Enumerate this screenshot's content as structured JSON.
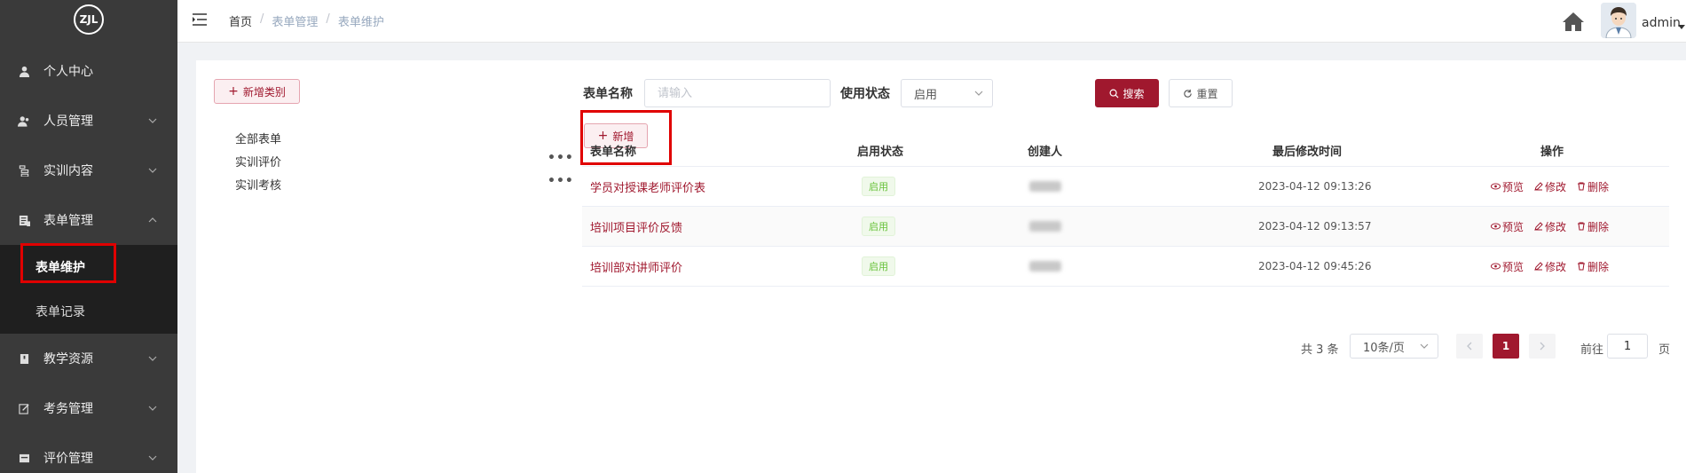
{
  "sidebar": {
    "logo_text": "ZJL",
    "items": [
      {
        "label": "个人中心"
      },
      {
        "label": "人员管理"
      },
      {
        "label": "实训内容"
      },
      {
        "label": "表单管理"
      },
      {
        "label": "表单维护"
      },
      {
        "label": "表单记录"
      },
      {
        "label": "教学资源"
      },
      {
        "label": "考务管理"
      },
      {
        "label": "评价管理"
      }
    ]
  },
  "header": {
    "breadcrumb": [
      "首页",
      "表单管理",
      "表单维护"
    ],
    "separator": "/",
    "username": "admin"
  },
  "left_panel": {
    "add_category_label": "新增类别",
    "tree": [
      {
        "label": "全部表单"
      },
      {
        "label": "实训评价",
        "more": "•••"
      },
      {
        "label": "实训考核",
        "more": "•••"
      }
    ]
  },
  "search": {
    "name_label": "表单名称",
    "name_placeholder": "请输入",
    "status_label": "使用状态",
    "status_value": "启用",
    "search_label": "搜索",
    "reset_label": "重置",
    "add_label": "新增"
  },
  "table": {
    "headers": [
      "表单名称",
      "启用状态",
      "创建人",
      "最后修改时间",
      "操作"
    ],
    "rows": [
      {
        "name": "学员对授课老师评价表",
        "status": "启用",
        "time": "2023-04-12 09:13:26"
      },
      {
        "name": "培训项目评价反馈",
        "status": "启用",
        "time": "2023-04-12 09:13:57"
      },
      {
        "name": "培训部对讲师评价",
        "status": "启用",
        "time": "2023-04-12 09:45:26"
      }
    ],
    "actions": {
      "preview": "预览",
      "edit": "修改",
      "delete": "删除"
    }
  },
  "pagination": {
    "total_text": "共 3 条",
    "page_size": "10条/页",
    "current_page": "1",
    "goto_prefix": "前往",
    "goto_value": "1",
    "goto_suffix": "页"
  },
  "colors": {
    "primary": "#a0182e",
    "sidebar_bg": "#3a3a3a",
    "submenu_bg": "#1f1f1f",
    "highlight_box": "#e00000",
    "tag_green": "#67c23a"
  }
}
